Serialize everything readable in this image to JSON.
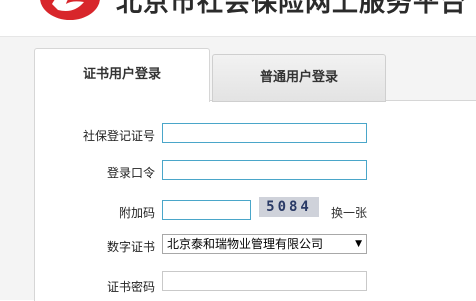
{
  "header": {
    "site_title": "北京市社会保险网上服务平台"
  },
  "tabs": [
    {
      "label": "证书用户登录",
      "active": true
    },
    {
      "label": "普通用户登录",
      "active": false
    }
  ],
  "form": {
    "registration_no": {
      "label": "社保登记证号",
      "value": ""
    },
    "password": {
      "label": "登录口令",
      "value": ""
    },
    "captcha": {
      "label": "附加码",
      "value": "",
      "image_text": "5084",
      "change_label": "换一张"
    },
    "certificate": {
      "label": "数字证书",
      "selected": "北京泰和瑞物业管理有限公司"
    },
    "cert_password": {
      "label": "证书密码",
      "value": ""
    }
  },
  "colors": {
    "logo_red": "#d8262b",
    "field_border": "#4aa6c9"
  }
}
